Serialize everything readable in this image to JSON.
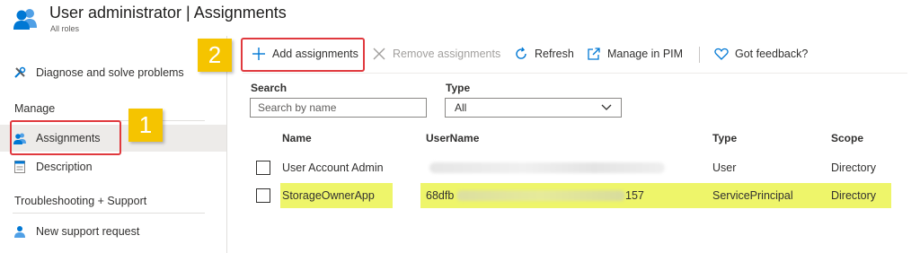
{
  "header": {
    "title": "User administrator | Assignments",
    "subtitle": "All roles"
  },
  "sidebar": {
    "items": [
      {
        "label": "Diagnose and solve problems",
        "icon": "wrench-icon"
      },
      {
        "label": "Assignments",
        "icon": "users-icon"
      },
      {
        "label": "Description",
        "icon": "document-icon"
      },
      {
        "label": "New support request",
        "icon": "support-person-icon"
      }
    ],
    "sections": [
      "Manage",
      "Troubleshooting + Support"
    ]
  },
  "toolbar": {
    "add_label": "Add assignments",
    "remove_label": "Remove assignments",
    "refresh_label": "Refresh",
    "manage_pim_label": "Manage in PIM",
    "feedback_label": "Got feedback?"
  },
  "filters": {
    "search_label": "Search",
    "search_placeholder": "Search by name",
    "type_label": "Type",
    "type_value": "All"
  },
  "table": {
    "columns": [
      "Name",
      "UserName",
      "Type",
      "Scope"
    ],
    "rows": [
      {
        "name": "User Account Admin",
        "username_prefix": "",
        "username_suffix": "",
        "type": "User",
        "scope": "Directory"
      },
      {
        "name": "StorageOwnerApp",
        "username_prefix": "68dfb",
        "username_suffix": "157",
        "type": "ServicePrincipal",
        "scope": "Directory"
      }
    ]
  },
  "callouts": [
    "1",
    "2"
  ],
  "colors": {
    "accent": "#0078d4",
    "callout_border": "#e0393e",
    "badge": "#f5c400",
    "row_highlight": "#eef56a"
  }
}
